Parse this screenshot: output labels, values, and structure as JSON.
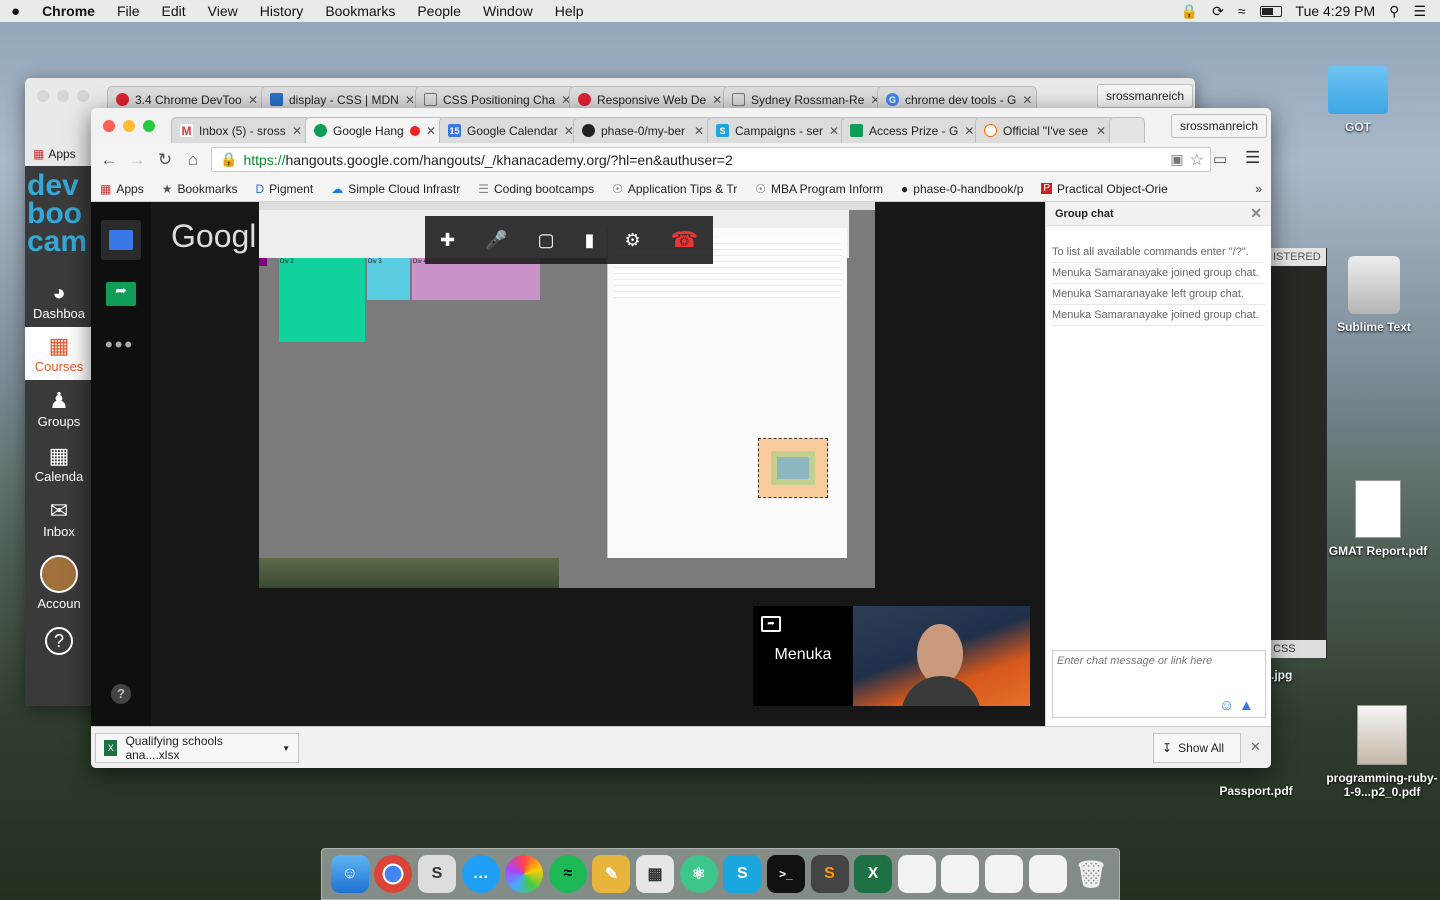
{
  "menubar": {
    "apple": "",
    "app": "Chrome",
    "items": [
      "File",
      "Edit",
      "View",
      "History",
      "Bookmarks",
      "People",
      "Window",
      "Help"
    ],
    "clock": "Tue 4:29 PM"
  },
  "desktop": {
    "got": "GOT",
    "sublime": "Sublime Text",
    "gmat": "GMAT Report.pdf",
    "ruby": "programming-ruby-1-9...p2_0.pdf",
    "passport": "Passport.pdf",
    "jpg": ".jpg",
    "istered": "ISTERED",
    "css": "CSS"
  },
  "back_window": {
    "tabs": [
      "3.4 Chrome DevToo",
      "display - CSS | MDN",
      "CSS Positioning Cha",
      "Responsive Web De",
      "Sydney Rossman-Re",
      "chrome dev tools - G"
    ],
    "profile": "srossmanreich",
    "apps": "Apps",
    "sidebar": {
      "dashboard": "Dashboa",
      "courses": "Courses",
      "groups": "Groups",
      "calendar": "Calenda",
      "inbox": "Inbox",
      "account": "Accoun"
    }
  },
  "front_window": {
    "tabs": [
      "Inbox (5) - sross",
      "Google Hang",
      "Google Calendar",
      "phase-0/my-ber",
      "Campaigns - ser",
      "Access Prize - G",
      "Official \"I've see"
    ],
    "profile": "srossmanreich",
    "url_scheme": "https://",
    "url_rest": "hangouts.google.com/hangouts/_/khanacademy.org/?hl=en&authuser=2",
    "bookmarks": [
      "Apps",
      "Bookmarks",
      "Pigment",
      "Simple Cloud Infrastr",
      "Coding bootcamps",
      "Application Tips & Tr",
      "MBA Program Inform",
      "phase-0-handbook/p",
      "Practical Object-Orie"
    ],
    "google_logo": "Googl",
    "participant": "Menuka",
    "shared": {
      "div2": "Div 2",
      "div3": "Div 3",
      "div4": "Div 4"
    },
    "chat": {
      "title": "Group chat",
      "messages": [
        "To list all available commands enter \"/?\".",
        "Menuka Samaranayake joined group chat.",
        "Menuka Samaranayake left group chat.",
        "Menuka Samaranayake joined group chat."
      ],
      "placeholder": "Enter chat message or link here"
    },
    "download": {
      "file": "Qualifying schools ana....xlsx",
      "show_all": "Show All"
    }
  },
  "colors": {
    "teal": "#11d19c",
    "lightblue": "#5bcde2",
    "pink": "#c893c9",
    "grey": "#808080"
  }
}
